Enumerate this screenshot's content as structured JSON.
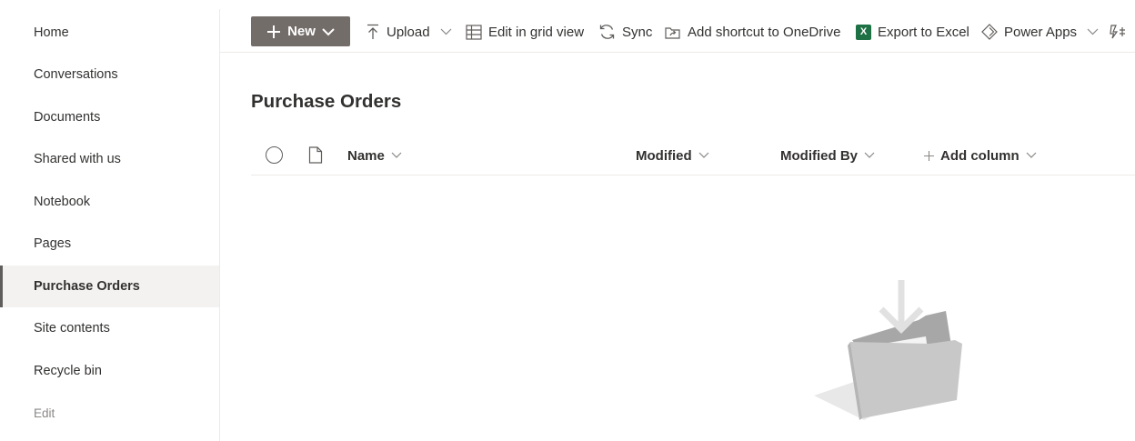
{
  "sidebar": {
    "items": [
      {
        "label": "Home"
      },
      {
        "label": "Conversations"
      },
      {
        "label": "Documents"
      },
      {
        "label": "Shared with us"
      },
      {
        "label": "Notebook"
      },
      {
        "label": "Pages"
      },
      {
        "label": "Purchase Orders",
        "selected": true
      },
      {
        "label": "Site contents"
      },
      {
        "label": "Recycle bin"
      }
    ],
    "edit_label": "Edit"
  },
  "commandbar": {
    "new_label": "New",
    "upload_label": "Upload",
    "grid_label": "Edit in grid view",
    "sync_label": "Sync",
    "shortcut_label": "Add shortcut to OneDrive",
    "excel_label": "Export to Excel",
    "excel_icon_letter": "X",
    "powerapps_label": "Power Apps"
  },
  "main": {
    "title": "Purchase Orders",
    "columns": {
      "name": "Name",
      "modified": "Modified",
      "modified_by": "Modified By",
      "add_column": "Add column"
    }
  },
  "colors": {
    "new_button_bg": "#736d6a",
    "selected_nav_bg": "#f3f2f1",
    "excel_green": "#1e7145"
  }
}
